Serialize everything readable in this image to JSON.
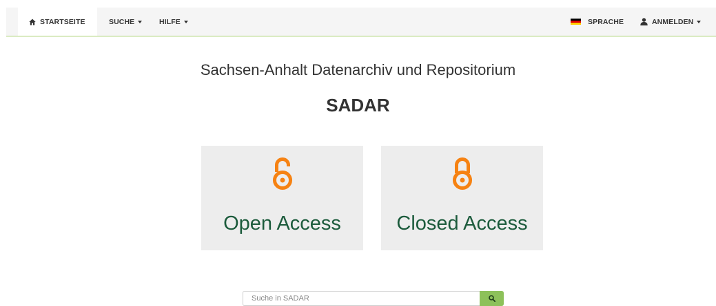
{
  "nav": {
    "home_label": "STARTSEITE",
    "search_label": "SUCHE",
    "help_label": "HILFE",
    "language_label": "SPRACHE",
    "login_label": "ANMELDEN"
  },
  "header": {
    "subtitle": "Sachsen-Anhalt Datenarchiv und Repositorium",
    "title": "SADAR"
  },
  "cards": [
    {
      "label": "Open Access",
      "icon": "open-lock-icon"
    },
    {
      "label": "Closed Access",
      "icon": "closed-lock-icon"
    }
  ],
  "search": {
    "placeholder": "Suche in SADAR",
    "value": ""
  },
  "colors": {
    "accent_green": "#8dc15a",
    "navbar_border": "#a6cf6b",
    "card_text": "#1c5b3c",
    "lock_orange": "#f68212",
    "card_bg": "#ededed",
    "navbar_bg": "#f5f5f5"
  }
}
